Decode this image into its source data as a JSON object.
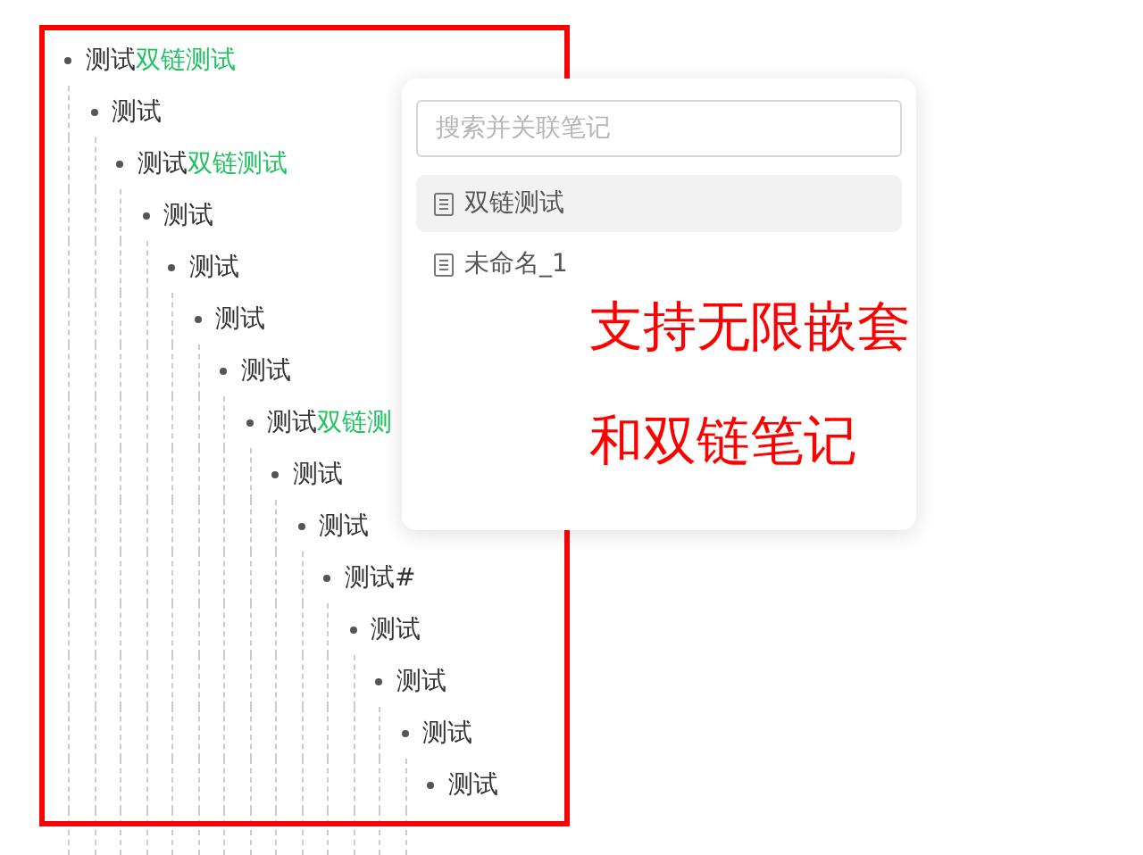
{
  "outline": [
    {
      "text": "测试",
      "link": "双链测试",
      "children": [
        {
          "text": "测试",
          "children": [
            {
              "text": "测试",
              "link": "双链测试",
              "children": [
                {
                  "text": "测试",
                  "children": [
                    {
                      "text": "测试",
                      "children": [
                        {
                          "text": "测试",
                          "children": [
                            {
                              "text": "测试",
                              "children": [
                                {
                                  "text": "测试",
                                  "link": "双链测",
                                  "children": [
                                    {
                                      "text": "测试",
                                      "children": [
                                        {
                                          "text": "测试",
                                          "children": [
                                            {
                                              "text": "测试#",
                                              "children": [
                                                {
                                                  "text": "测试",
                                                  "children": [
                                                    {
                                                      "text": "测试",
                                                      "children": [
                                                        {
                                                          "text": "测试",
                                                          "children": [
                                                            {
                                                              "text": "测试"
                                                            }
                                                          ]
                                                        }
                                                      ]
                                                    }
                                                  ]
                                                }
                                              ]
                                            }
                                          ]
                                        }
                                      ]
                                    }
                                  ]
                                }
                              ]
                            }
                          ]
                        }
                      ]
                    }
                  ]
                }
              ]
            }
          ]
        }
      ]
    }
  ],
  "link_popup": {
    "search": {
      "placeholder": "搜索并关联笔记"
    },
    "results": [
      {
        "title": "双链测试",
        "selected": true
      },
      {
        "title": "未命名_1",
        "selected": false
      }
    ]
  },
  "annotation": {
    "lines": [
      "支持无限嵌套",
      "和双链笔记"
    ]
  }
}
